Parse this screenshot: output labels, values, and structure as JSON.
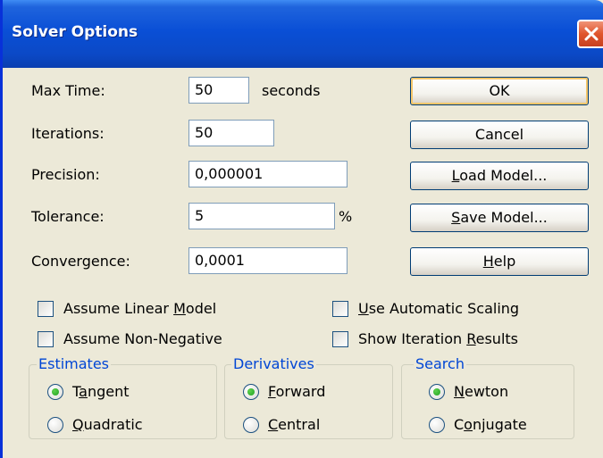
{
  "window": {
    "title": "Solver Options"
  },
  "fields": {
    "max_time": {
      "label_pre": "Max Time:",
      "value": "50",
      "suffix": "seconds"
    },
    "iterations": {
      "label": "Iterations:",
      "value": "50"
    },
    "precision": {
      "label": "Precision:",
      "value": "0,000001"
    },
    "tolerance": {
      "label": "Tolerance:",
      "value": "5",
      "suffix": "%"
    },
    "convergence": {
      "label": "Convergence:",
      "value": "0,0001"
    }
  },
  "buttons": {
    "ok": "OK",
    "cancel": "Cancel",
    "load_pre": "",
    "load_u": "L",
    "load_post": "oad Model...",
    "save_pre": "",
    "save_u": "S",
    "save_post": "ave Model...",
    "help_pre": "",
    "help_u": "H",
    "help_post": "elp"
  },
  "checkboxes": {
    "linear": {
      "pre": "Assume Linear ",
      "u": "M",
      "post": "odel",
      "checked": false
    },
    "nonneg": {
      "pre": "Assume Non-Negative",
      "u": "",
      "post": "",
      "checked": false
    },
    "scaling": {
      "pre": "",
      "u": "U",
      "post": "se Automatic Scaling",
      "checked": false
    },
    "iter_results": {
      "pre": "Show Iteration ",
      "u": "R",
      "post": "esults",
      "checked": false
    }
  },
  "groups": {
    "estimates": {
      "title": "Estimates",
      "opt1": {
        "pre": "T",
        "u": "a",
        "post": "ngent",
        "selected": true
      },
      "opt2": {
        "pre": "",
        "u": "Q",
        "post": "uadratic",
        "selected": false
      }
    },
    "derivatives": {
      "title": "Derivatives",
      "opt1": {
        "pre": "",
        "u": "F",
        "post": "orward",
        "selected": true
      },
      "opt2": {
        "pre": "",
        "u": "C",
        "post": "entral",
        "selected": false
      }
    },
    "search": {
      "title": "Search",
      "opt1": {
        "pre": "",
        "u": "N",
        "post": "ewton",
        "selected": true
      },
      "opt2": {
        "pre": "C",
        "u": "o",
        "post": "njugate",
        "selected": false
      }
    }
  },
  "colors": {
    "titlebar": "#0a4fd6",
    "group_title": "#0046d5",
    "dialog_bg": "#ece9d8",
    "close": "#e0552c"
  }
}
